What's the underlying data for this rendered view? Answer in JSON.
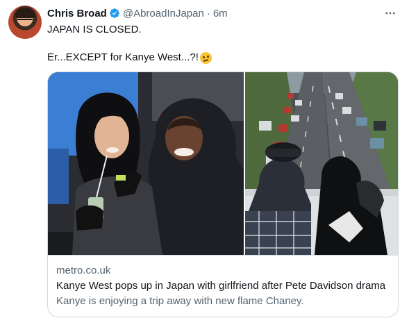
{
  "user": {
    "display_name": "Chris Broad",
    "handle": "@AbroadInJapan",
    "separator": "·",
    "time": "6m",
    "verified": true
  },
  "tweet": {
    "line1": "JAPAN IS CLOSED.",
    "line2": "Er...EXCEPT for Kanye West...?!"
  },
  "more_menu_icon": "more-dots-icon",
  "card": {
    "domain": "metro.co.uk",
    "title": "Kanye West pops up in Japan with girlfriend after Pete Davidson drama",
    "description": "Kanye is enjoying a trip away with new flame Chaney."
  },
  "colors": {
    "text_primary": "#0f1419",
    "text_secondary": "#536471",
    "verified_blue": "#1d9bf0",
    "border": "#cfd9de"
  }
}
